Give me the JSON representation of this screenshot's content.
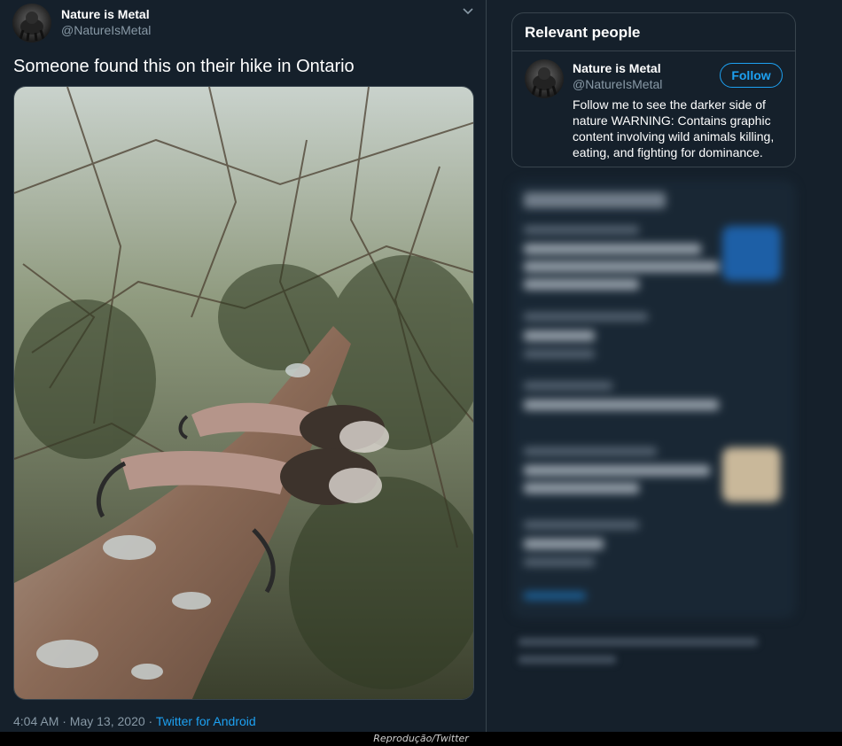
{
  "tweet": {
    "author_name": "Nature is Metal",
    "author_handle": "@NatureIsMetal",
    "text": "Someone found this on their hike in Ontario",
    "timestamp": "4:04 AM · May 13, 2020 · ",
    "source": "Twitter for Android",
    "image_subject": "bird-talons-gripping-tree-branch"
  },
  "relevant_people": {
    "title": "Relevant people",
    "person": {
      "name": "Nature is Metal",
      "handle": "@NatureIsMetal",
      "follow_label": "Follow",
      "bio": "Follow me to see the darker side of nature WARNING: Contains graphic content involving wild animals killing, eating, and fighting for dominance."
    }
  },
  "credit": "Reprodução/Twitter",
  "colors": {
    "background": "#15202b",
    "accent": "#1da1f2",
    "secondary_text": "#8899a6",
    "border": "#38444d"
  }
}
